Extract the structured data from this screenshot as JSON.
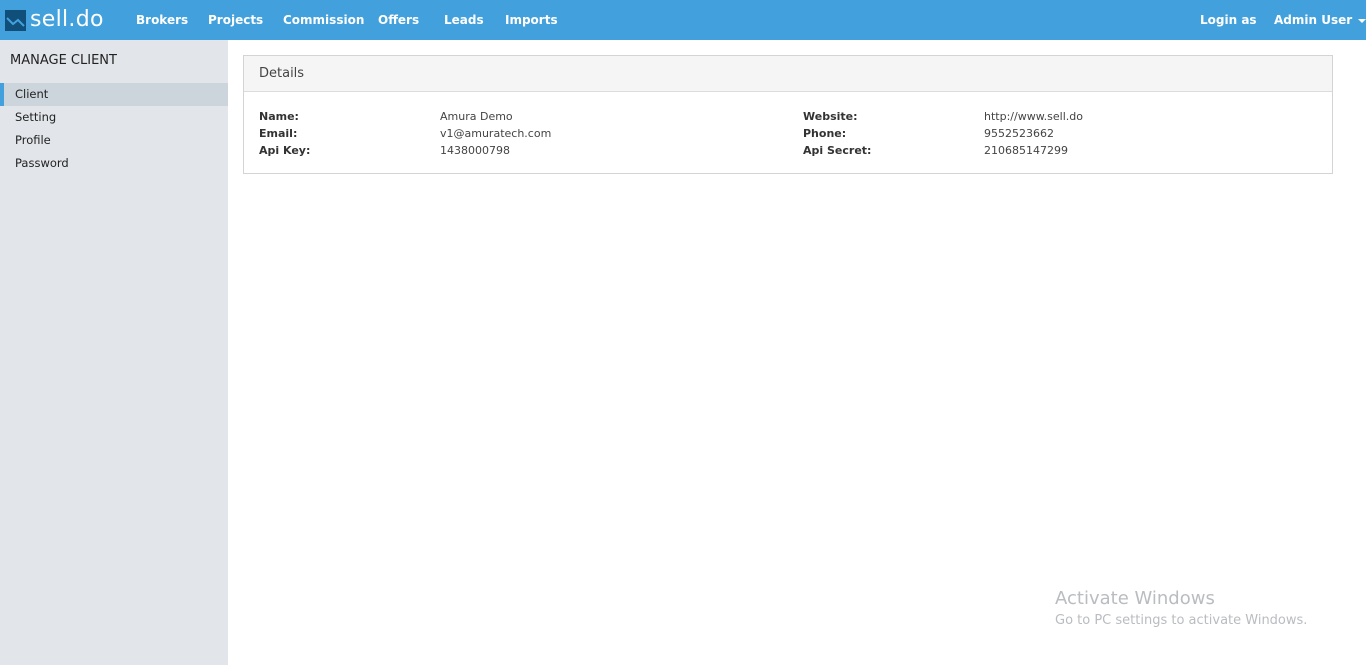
{
  "brand": {
    "name": "sell.do"
  },
  "nav": {
    "items": [
      "Brokers",
      "Projects",
      "Commission",
      "Offers",
      "Leads",
      "Imports"
    ],
    "login_as": "Login as",
    "user": "Admin User"
  },
  "sidebar": {
    "title": "MANAGE CLIENT",
    "items": [
      {
        "label": "Client",
        "active": true
      },
      {
        "label": "Setting",
        "active": false
      },
      {
        "label": "Profile",
        "active": false
      },
      {
        "label": "Password",
        "active": false
      }
    ]
  },
  "details": {
    "title": "Details",
    "fields": [
      {
        "label": "Name:",
        "value": "Amura Demo"
      },
      {
        "label": "Email:",
        "value": "v1@amuratech.com"
      },
      {
        "label": "Api Key:",
        "value": "1438000798"
      },
      {
        "label": "Website:",
        "value": "http://www.sell.do"
      },
      {
        "label": "Phone:",
        "value": "9552523662"
      },
      {
        "label": "Api Secret:",
        "value": "210685147299"
      }
    ]
  },
  "watermark": {
    "title": "Activate Windows",
    "subtitle": "Go to PC settings to activate Windows."
  },
  "colors": {
    "navbar": "#42a1dc",
    "sidebar": "#e2e6ea",
    "sidebar_active": "#cdd5dc"
  }
}
